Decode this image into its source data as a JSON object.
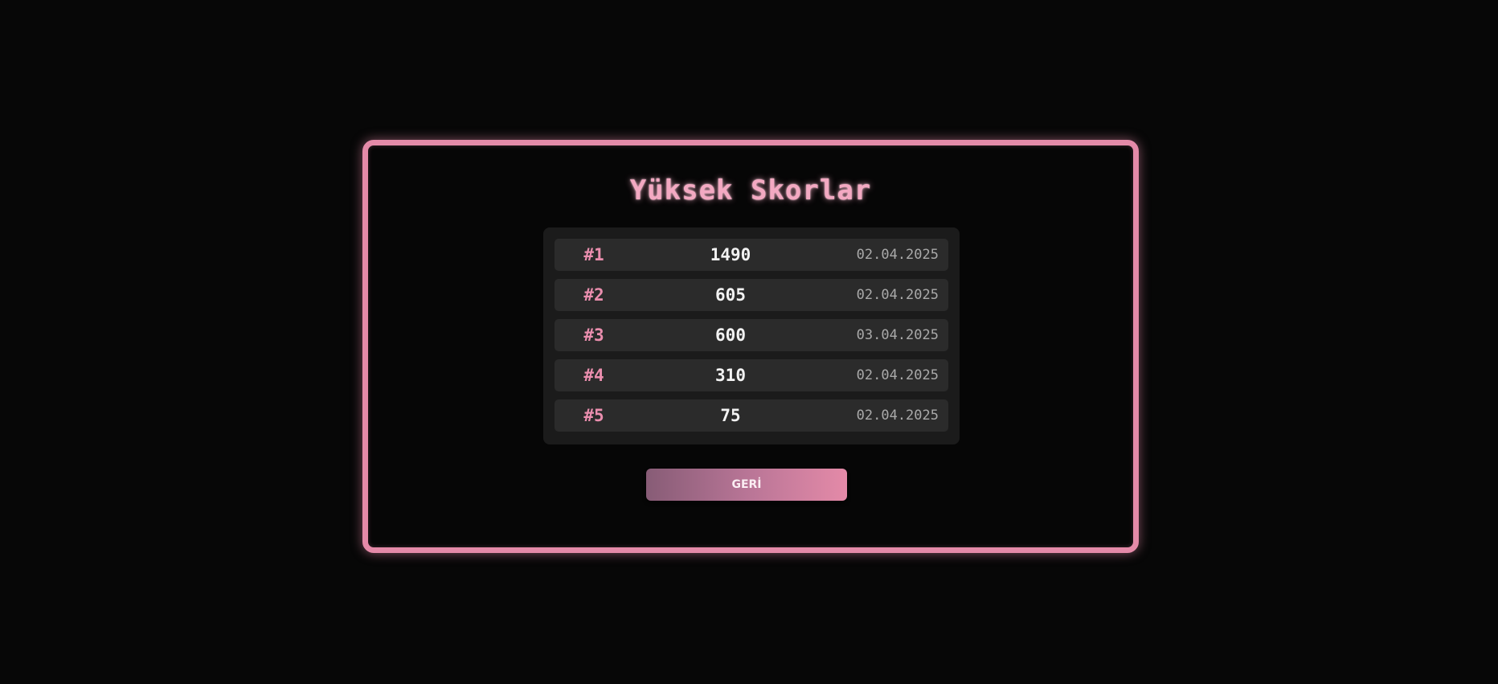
{
  "highscores": {
    "title": "Yüksek Skorlar",
    "entries": [
      {
        "rank": "#1",
        "score": "1490",
        "date": "02.04.2025"
      },
      {
        "rank": "#2",
        "score": "605",
        "date": "02.04.2025"
      },
      {
        "rank": "#3",
        "score": "600",
        "date": "03.04.2025"
      },
      {
        "rank": "#4",
        "score": "310",
        "date": "02.04.2025"
      },
      {
        "rank": "#5",
        "score": "75",
        "date": "02.04.2025"
      }
    ],
    "back_label": "GERİ"
  },
  "colors": {
    "accent": "#e48aa8",
    "background": "#070707",
    "row": "#2b2b2b",
    "list": "#1b1b1b"
  }
}
